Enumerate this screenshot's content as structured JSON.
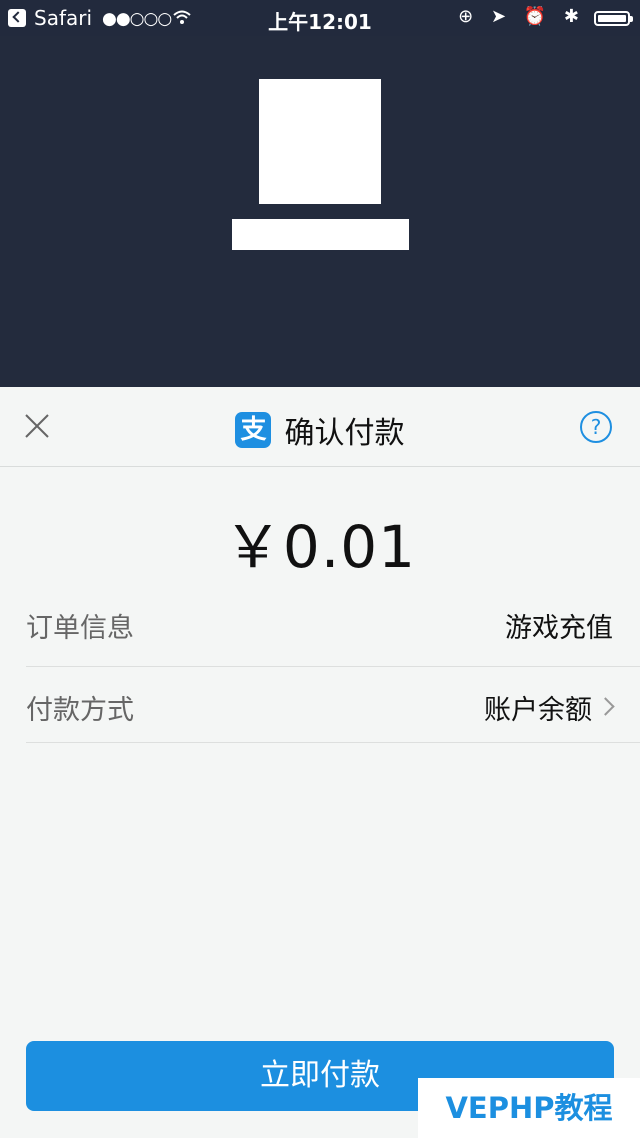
{
  "status_bar": {
    "back_app": "Safari",
    "signal": "●●○○○",
    "time": "上午12:01",
    "icons": "⊕ ➤ ⏰ ✱"
  },
  "sheet": {
    "title": "确认付款",
    "alipay_glyph": "支",
    "help_glyph": "?",
    "amount": "￥0.01",
    "rows": [
      {
        "label": "订单信息",
        "value": "游戏充值"
      },
      {
        "label": "付款方式",
        "value": "账户余额"
      }
    ],
    "pay_button": "立即付款"
  },
  "watermark": "VEPHP教程",
  "colors": {
    "accent": "#1c8fe0",
    "hero_bg": "#232b3d",
    "sheet_bg": "#f4f6f5"
  }
}
